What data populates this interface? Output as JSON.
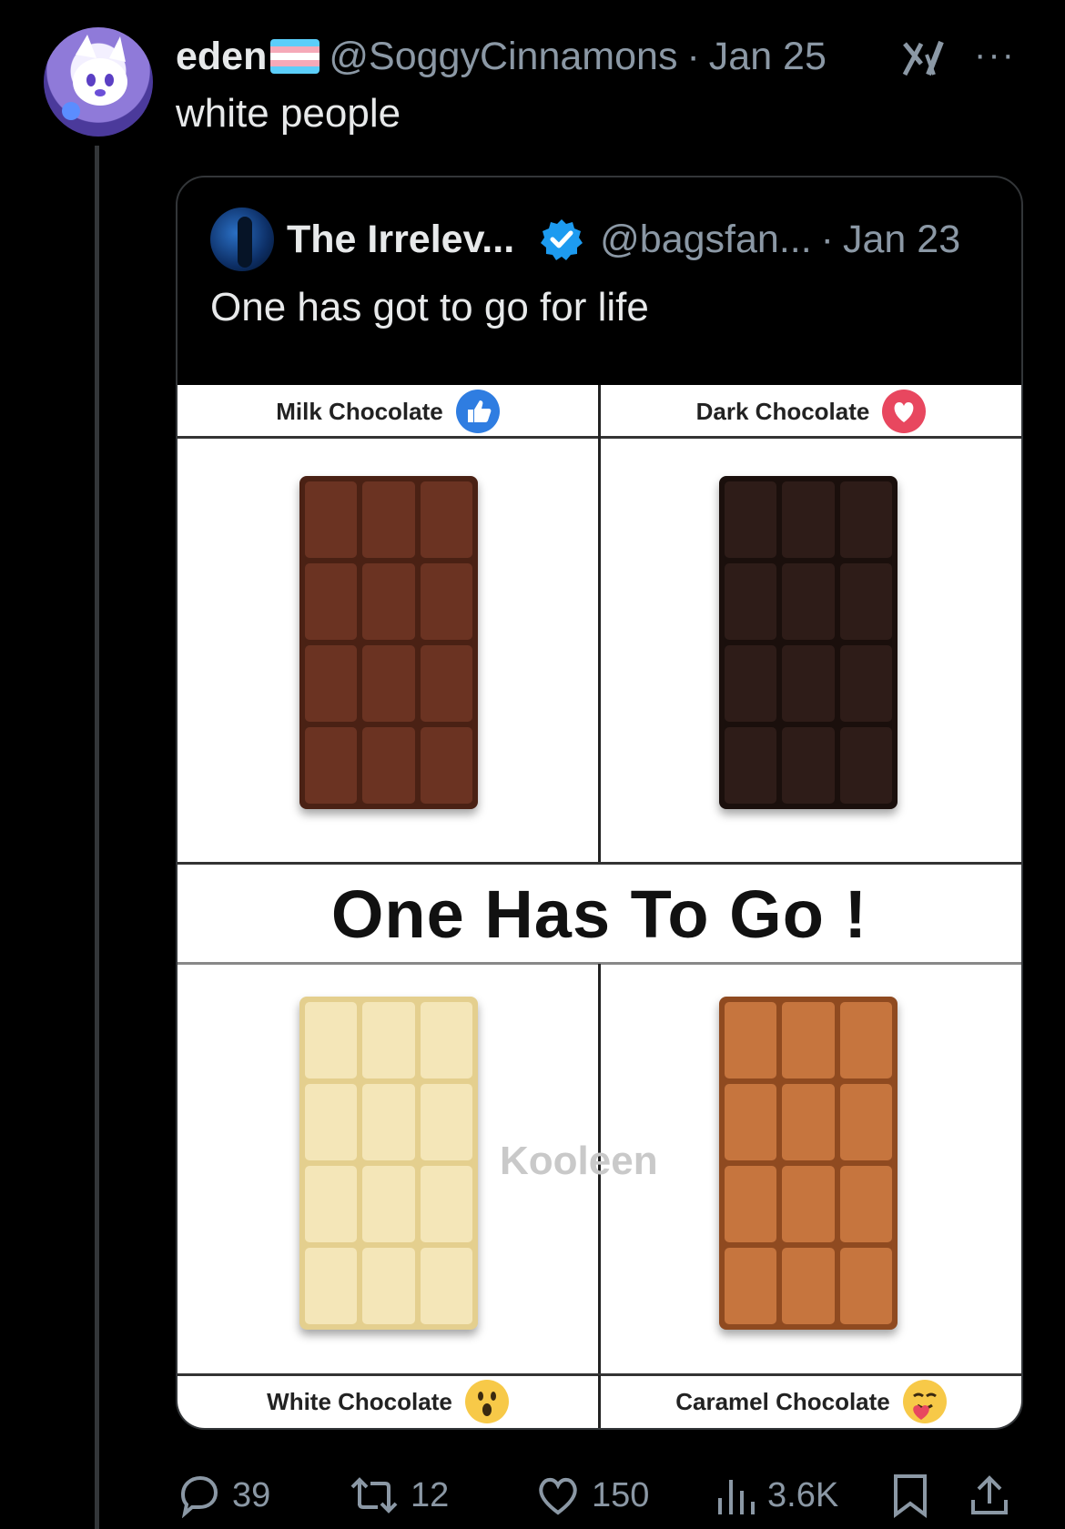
{
  "tweet": {
    "author_name": "eden",
    "handle": "@SoggyCinnamons",
    "separator": "·",
    "date": "Jan 25",
    "text": "white people",
    "more_label": "···",
    "flag_colors": [
      "#5BCEFA",
      "#F5A9B8",
      "#FFFFFF",
      "#F5A9B8",
      "#5BCEFA"
    ]
  },
  "quote": {
    "author_name": "The Irrelev...",
    "handle": "@bagsfan...",
    "separator": "·",
    "date": "Jan 23",
    "text": "One has got to go for life"
  },
  "meme": {
    "top_left_label": "Milk Chocolate",
    "top_right_label": "Dark Chocolate",
    "title": "One Has To Go !",
    "bottom_left_label": "White Chocolate",
    "bottom_right_label": "Caramel Chocolate",
    "watermark": "Kooleen",
    "bar_colors": {
      "milk": "#6b3322",
      "dark": "#2e1c18",
      "white": "#f4e6b8",
      "caramel": "#c6753e"
    }
  },
  "actions": {
    "replies": "39",
    "retweets": "12",
    "likes": "150",
    "views": "3.6K"
  }
}
